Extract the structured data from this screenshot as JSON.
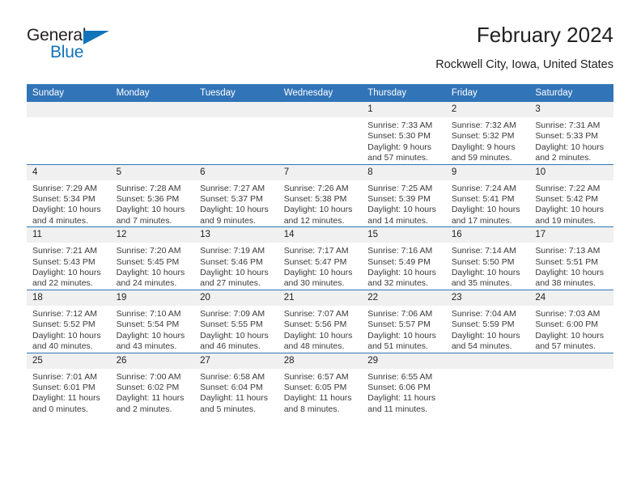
{
  "brand": {
    "name_top": "General",
    "name_bottom": "Blue",
    "triangle_color": "#1173b9",
    "text_color": "#231f20"
  },
  "header": {
    "title": "February 2024",
    "subtitle": "Rockwell City, Iowa, United States"
  },
  "theme": {
    "header_blue": "#3274b8",
    "daynum_band": "#f0f0f0",
    "cell_bg": "#ffffff",
    "text": "#222222"
  },
  "calendar": {
    "weekday_headers": [
      "Sunday",
      "Monday",
      "Tuesday",
      "Wednesday",
      "Thursday",
      "Friday",
      "Saturday"
    ],
    "weeks": [
      [
        {
          "day": "",
          "lines": []
        },
        {
          "day": "",
          "lines": []
        },
        {
          "day": "",
          "lines": []
        },
        {
          "day": "",
          "lines": []
        },
        {
          "day": "1",
          "lines": [
            "Sunrise: 7:33 AM",
            "Sunset: 5:30 PM",
            "Daylight: 9 hours and 57 minutes."
          ]
        },
        {
          "day": "2",
          "lines": [
            "Sunrise: 7:32 AM",
            "Sunset: 5:32 PM",
            "Daylight: 9 hours and 59 minutes."
          ]
        },
        {
          "day": "3",
          "lines": [
            "Sunrise: 7:31 AM",
            "Sunset: 5:33 PM",
            "Daylight: 10 hours and 2 minutes."
          ]
        }
      ],
      [
        {
          "day": "4",
          "lines": [
            "Sunrise: 7:29 AM",
            "Sunset: 5:34 PM",
            "Daylight: 10 hours and 4 minutes."
          ]
        },
        {
          "day": "5",
          "lines": [
            "Sunrise: 7:28 AM",
            "Sunset: 5:36 PM",
            "Daylight: 10 hours and 7 minutes."
          ]
        },
        {
          "day": "6",
          "lines": [
            "Sunrise: 7:27 AM",
            "Sunset: 5:37 PM",
            "Daylight: 10 hours and 9 minutes."
          ]
        },
        {
          "day": "7",
          "lines": [
            "Sunrise: 7:26 AM",
            "Sunset: 5:38 PM",
            "Daylight: 10 hours and 12 minutes."
          ]
        },
        {
          "day": "8",
          "lines": [
            "Sunrise: 7:25 AM",
            "Sunset: 5:39 PM",
            "Daylight: 10 hours and 14 minutes."
          ]
        },
        {
          "day": "9",
          "lines": [
            "Sunrise: 7:24 AM",
            "Sunset: 5:41 PM",
            "Daylight: 10 hours and 17 minutes."
          ]
        },
        {
          "day": "10",
          "lines": [
            "Sunrise: 7:22 AM",
            "Sunset: 5:42 PM",
            "Daylight: 10 hours and 19 minutes."
          ]
        }
      ],
      [
        {
          "day": "11",
          "lines": [
            "Sunrise: 7:21 AM",
            "Sunset: 5:43 PM",
            "Daylight: 10 hours and 22 minutes."
          ]
        },
        {
          "day": "12",
          "lines": [
            "Sunrise: 7:20 AM",
            "Sunset: 5:45 PM",
            "Daylight: 10 hours and 24 minutes."
          ]
        },
        {
          "day": "13",
          "lines": [
            "Sunrise: 7:19 AM",
            "Sunset: 5:46 PM",
            "Daylight: 10 hours and 27 minutes."
          ]
        },
        {
          "day": "14",
          "lines": [
            "Sunrise: 7:17 AM",
            "Sunset: 5:47 PM",
            "Daylight: 10 hours and 30 minutes."
          ]
        },
        {
          "day": "15",
          "lines": [
            "Sunrise: 7:16 AM",
            "Sunset: 5:49 PM",
            "Daylight: 10 hours and 32 minutes."
          ]
        },
        {
          "day": "16",
          "lines": [
            "Sunrise: 7:14 AM",
            "Sunset: 5:50 PM",
            "Daylight: 10 hours and 35 minutes."
          ]
        },
        {
          "day": "17",
          "lines": [
            "Sunrise: 7:13 AM",
            "Sunset: 5:51 PM",
            "Daylight: 10 hours and 38 minutes."
          ]
        }
      ],
      [
        {
          "day": "18",
          "lines": [
            "Sunrise: 7:12 AM",
            "Sunset: 5:52 PM",
            "Daylight: 10 hours and 40 minutes."
          ]
        },
        {
          "day": "19",
          "lines": [
            "Sunrise: 7:10 AM",
            "Sunset: 5:54 PM",
            "Daylight: 10 hours and 43 minutes."
          ]
        },
        {
          "day": "20",
          "lines": [
            "Sunrise: 7:09 AM",
            "Sunset: 5:55 PM",
            "Daylight: 10 hours and 46 minutes."
          ]
        },
        {
          "day": "21",
          "lines": [
            "Sunrise: 7:07 AM",
            "Sunset: 5:56 PM",
            "Daylight: 10 hours and 48 minutes."
          ]
        },
        {
          "day": "22",
          "lines": [
            "Sunrise: 7:06 AM",
            "Sunset: 5:57 PM",
            "Daylight: 10 hours and 51 minutes."
          ]
        },
        {
          "day": "23",
          "lines": [
            "Sunrise: 7:04 AM",
            "Sunset: 5:59 PM",
            "Daylight: 10 hours and 54 minutes."
          ]
        },
        {
          "day": "24",
          "lines": [
            "Sunrise: 7:03 AM",
            "Sunset: 6:00 PM",
            "Daylight: 10 hours and 57 minutes."
          ]
        }
      ],
      [
        {
          "day": "25",
          "lines": [
            "Sunrise: 7:01 AM",
            "Sunset: 6:01 PM",
            "Daylight: 11 hours and 0 minutes."
          ]
        },
        {
          "day": "26",
          "lines": [
            "Sunrise: 7:00 AM",
            "Sunset: 6:02 PM",
            "Daylight: 11 hours and 2 minutes."
          ]
        },
        {
          "day": "27",
          "lines": [
            "Sunrise: 6:58 AM",
            "Sunset: 6:04 PM",
            "Daylight: 11 hours and 5 minutes."
          ]
        },
        {
          "day": "28",
          "lines": [
            "Sunrise: 6:57 AM",
            "Sunset: 6:05 PM",
            "Daylight: 11 hours and 8 minutes."
          ]
        },
        {
          "day": "29",
          "lines": [
            "Sunrise: 6:55 AM",
            "Sunset: 6:06 PM",
            "Daylight: 11 hours and 11 minutes."
          ]
        },
        {
          "day": "",
          "lines": []
        },
        {
          "day": "",
          "lines": []
        }
      ]
    ]
  }
}
